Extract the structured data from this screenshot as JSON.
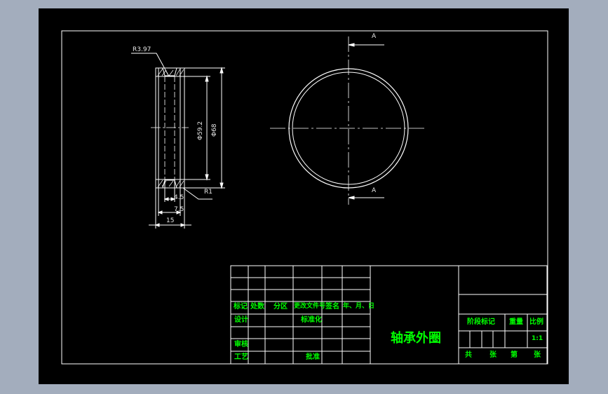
{
  "colors": {
    "workspace": "#a3adbd",
    "sheet": "#000000",
    "outline": "#ffffff",
    "title_text": "#00ff00",
    "center_line": "#ffffff"
  },
  "dimensions": {
    "fillet_top": "R3.97",
    "fillet_bottom": "R1",
    "inner_diameter": "Φ59.2",
    "outer_diameter": "Φ68",
    "groove_offset": "4.5",
    "groove_width": "7.5",
    "total_width": "15",
    "section_mark_top": "A",
    "section_mark_bottom": "A"
  },
  "title_block": {
    "part_name": "轴承外圈",
    "rev_headers": [
      "标记",
      "处数",
      "分区",
      "更改文件号",
      "签名",
      "年、月、日"
    ],
    "design": "设计",
    "standardize": "标准化",
    "review": "审核",
    "process": "工艺",
    "approve": "批准",
    "stage_mark": "阶段标记",
    "weight": "重量",
    "scale_label": "比例",
    "scale_value": "1:1",
    "total": "共",
    "sheets1": "张",
    "page_no": "第",
    "sheets2": "张"
  }
}
